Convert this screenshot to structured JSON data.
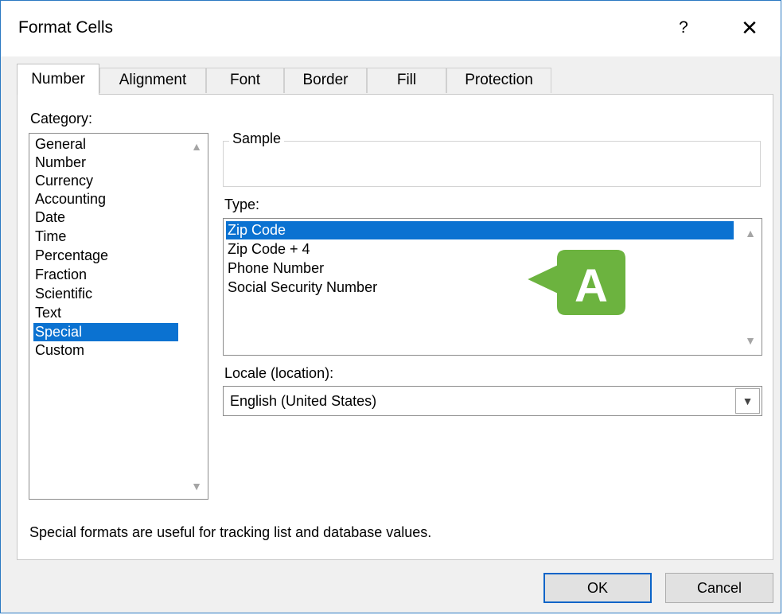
{
  "window": {
    "title": "Format Cells",
    "help_label": "?",
    "close_label": "✕"
  },
  "tabs": [
    {
      "label": "Number",
      "active": true
    },
    {
      "label": "Alignment",
      "active": false
    },
    {
      "label": "Font",
      "active": false
    },
    {
      "label": "Border",
      "active": false
    },
    {
      "label": "Fill",
      "active": false
    },
    {
      "label": "Protection",
      "active": false
    }
  ],
  "category": {
    "label": "Category:",
    "items": [
      "General",
      "Number",
      "Currency",
      "Accounting",
      "Date",
      "Time",
      "Percentage",
      "Fraction",
      "Scientific",
      "Text",
      "Special",
      "Custom"
    ],
    "selected": "Special"
  },
  "sample": {
    "label": "Sample"
  },
  "type": {
    "label": "Type:",
    "items": [
      "Zip Code",
      "Zip Code + 4",
      "Phone Number",
      "Social Security Number"
    ],
    "selected": "Zip Code"
  },
  "locale": {
    "label": "Locale (location):",
    "value": "English (United States)"
  },
  "description": "Special formats are useful for tracking list and database values.",
  "buttons": {
    "ok_label": "OK",
    "cancel_label": "Cancel"
  },
  "callout": {
    "letter": "A",
    "color": "#6cb33f"
  },
  "colors": {
    "selection": "#0b72d1",
    "title_border": "#2b79c2"
  },
  "icons": {
    "scroll_up": "chevron-up-icon",
    "scroll_down": "chevron-down-icon",
    "dropdown": "chevron-down-icon"
  }
}
